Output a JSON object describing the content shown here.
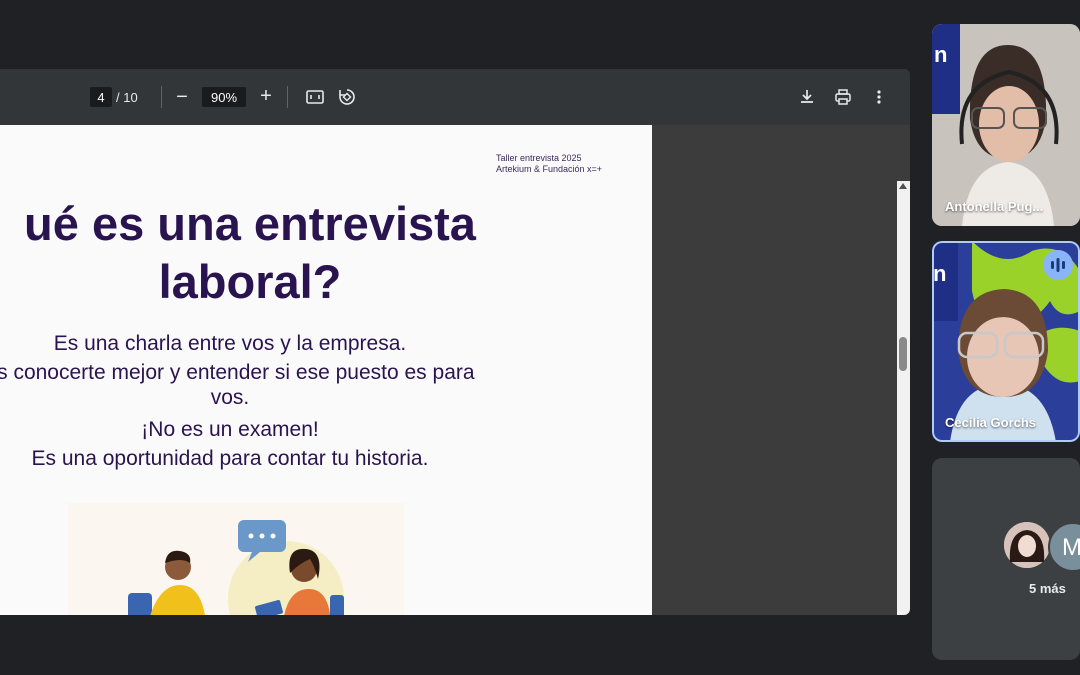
{
  "toolbar": {
    "current_page": "4",
    "total_pages": "/ 10",
    "zoom_minus": "−",
    "zoom_value": "90%",
    "zoom_plus": "+"
  },
  "slide": {
    "corner_line1": "Taller entrevista 2025",
    "corner_line2": "Artekium & Fundación x=+",
    "title_line1": "ué es una entrevista",
    "title_line2": "laboral?",
    "body": [
      "Es una charla entre vos y la empresa.",
      "es conocerte mejor y entender si ese puesto es para",
      "vos.",
      "¡No es un examen!",
      "Es una oportunidad para contar tu historia."
    ]
  },
  "participants": {
    "tile1_name": "Antonella Pug...",
    "tile2_name": "Cecilia Gorchs",
    "avatar_letter": "M",
    "more_label": "5 más"
  },
  "colors": {
    "slide_text": "#2a1450",
    "toolbar_bg": "#323639",
    "meet_bg": "#202124",
    "active_speaker": "#8ab4f8"
  }
}
